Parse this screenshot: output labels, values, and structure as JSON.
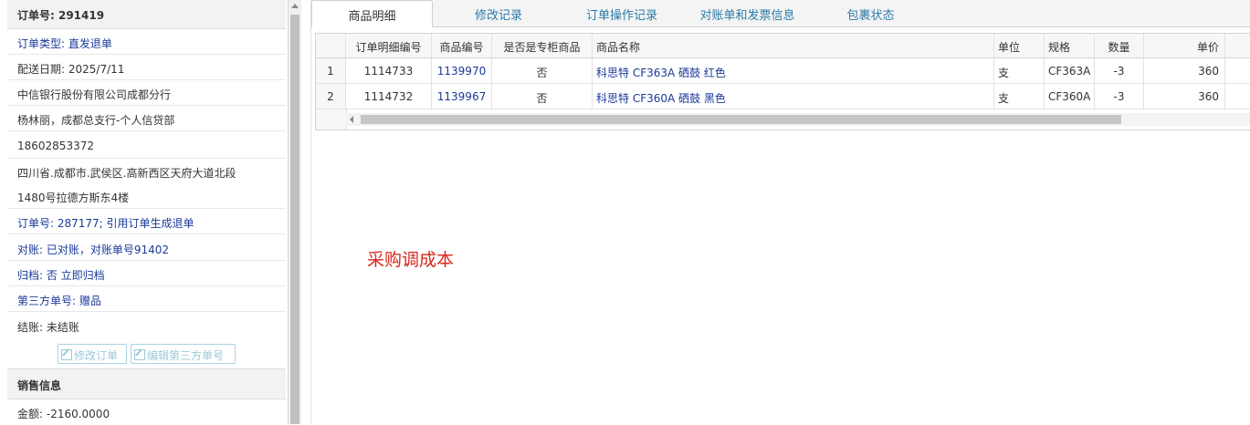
{
  "order": {
    "number_line": "订单号:  291419",
    "type_line": "订单类型:  直发退单",
    "delivery_date_line": "配送日期:  2025/7/11",
    "company": "中信银行股份有限公司成都分行",
    "contact": "杨林丽，成都总支行-个人信贷部",
    "phone": "18602853372",
    "address_line1": "四川省.成都市.武侯区.高新西区天府大道北段",
    "address_line2": "1480号拉德方斯东4楼",
    "ref_order_line": "订单号:  287177;  引用订单生成退单",
    "reconcile_line": "对账:  已对账，对账单号91402",
    "archive_line": "归档:   否 立即归档",
    "third_party_line": "第三方单号:  赠品",
    "settle_line": "结账:  未结账",
    "buttons": {
      "edit_order": "修改订单",
      "edit_third_party": "编辑第三方单号"
    }
  },
  "sales": {
    "header": "销售信息",
    "amount_line": "金额:  -2160.0000"
  },
  "tabs": [
    {
      "label": "商品明细",
      "active": true
    },
    {
      "label": "修改记录",
      "active": false
    },
    {
      "label": "订单操作记录",
      "active": false
    },
    {
      "label": "对账单和发票信息",
      "active": false
    },
    {
      "label": "包裹状态",
      "active": false
    }
  ],
  "grid": {
    "columns": [
      "订单明细编号",
      "商品编号",
      "是否是专柜商品",
      "商品名称",
      "单位",
      "规格",
      "数量",
      "单价"
    ],
    "rows": [
      {
        "rownum": "1",
        "detail_id": "1114733",
        "product_id": "1139970",
        "counter": "否",
        "name": "科思特 CF363A 硒鼓 红色",
        "unit": "支",
        "spec": "CF363A",
        "qty": "-3",
        "price": "360"
      },
      {
        "rownum": "2",
        "detail_id": "1114732",
        "product_id": "1139967",
        "counter": "否",
        "name": "科思特 CF360A 硒鼓 黑色",
        "unit": "支",
        "spec": "CF360A",
        "qty": "-3",
        "price": "360"
      }
    ]
  },
  "note": "采购调成本",
  "colors": {
    "link": "#1a3a99",
    "tab_link": "#2a7aa8",
    "note": "#d9261c"
  }
}
